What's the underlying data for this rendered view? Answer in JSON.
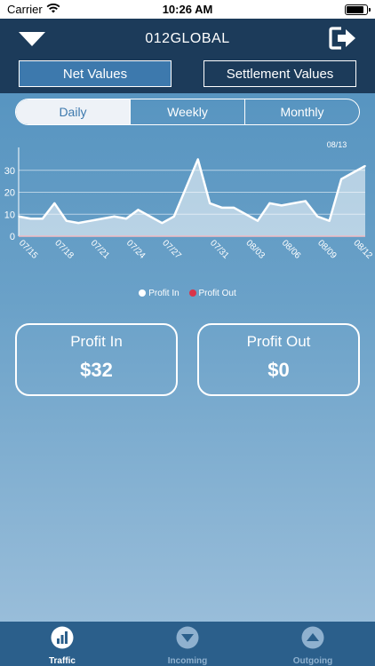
{
  "status": {
    "carrier": "Carrier",
    "time": "10:26 AM"
  },
  "nav": {
    "title": "012GLOBAL",
    "menu_icon": "caret-down-icon",
    "logout_icon": "logout-icon"
  },
  "value_toggle": {
    "net": "Net Values",
    "settlement": "Settlement Values",
    "selected": "net"
  },
  "period": {
    "daily": "Daily",
    "weekly": "Weekly",
    "monthly": "Monthly",
    "selected": "daily"
  },
  "chart_data": {
    "type": "area",
    "annotation": "08/13",
    "x_labels": [
      "07/15",
      "07/18",
      "07/21",
      "07/24",
      "07/27",
      "07/31",
      "08/03",
      "08/06",
      "08/09",
      "08/12"
    ],
    "x": [
      "07/15",
      "07/16",
      "07/17",
      "07/18",
      "07/19",
      "07/20",
      "07/21",
      "07/22",
      "07/23",
      "07/24",
      "07/25",
      "07/26",
      "07/27",
      "07/28",
      "07/29",
      "07/30",
      "07/31",
      "08/01",
      "08/02",
      "08/03",
      "08/04",
      "08/05",
      "08/06",
      "08/07",
      "08/08",
      "08/09",
      "08/10",
      "08/11",
      "08/12",
      "08/13"
    ],
    "yticks": [
      0,
      10,
      20,
      30
    ],
    "ylim": [
      0,
      38
    ],
    "grid": true,
    "series": [
      {
        "name": "Profit In",
        "color": "#ffffff",
        "values": [
          9,
          8,
          8,
          15,
          7,
          6,
          7,
          8,
          9,
          8,
          12,
          9,
          6,
          9,
          22,
          35,
          15,
          13,
          13,
          10,
          7,
          15,
          14,
          15,
          16,
          9,
          7,
          26,
          29,
          32
        ]
      },
      {
        "name": "Profit Out",
        "color": "#d9344a",
        "values": [
          0,
          0,
          0,
          0,
          0,
          0,
          0,
          0,
          0,
          0,
          0,
          0,
          0,
          0,
          0,
          0,
          0,
          0,
          0,
          0,
          0,
          0,
          0,
          0,
          0,
          0,
          0,
          0,
          0,
          0
        ]
      }
    ]
  },
  "cards": {
    "profit_in": {
      "label": "Profit In",
      "value": "$32"
    },
    "profit_out": {
      "label": "Profit Out",
      "value": "$0"
    }
  },
  "tabs": [
    {
      "label": "Traffic",
      "icon": "bar-chart-icon",
      "active": true
    },
    {
      "label": "Incoming",
      "icon": "arrow-down-circle-icon",
      "active": false
    },
    {
      "label": "Outgoing",
      "icon": "arrow-up-circle-icon",
      "active": false
    }
  ]
}
